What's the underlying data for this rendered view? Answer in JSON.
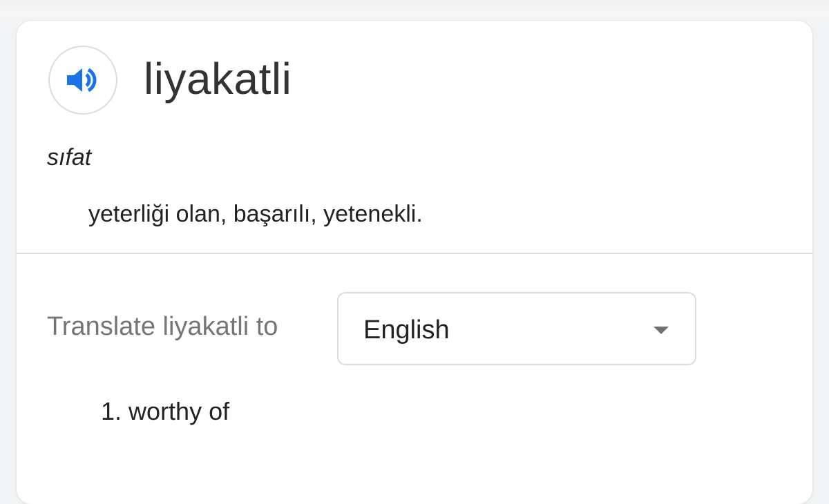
{
  "entry": {
    "word": "liyakatli",
    "part_of_speech": "sıfat",
    "definition": "yeterliği olan, başarılı, yetenekli."
  },
  "icons": {
    "speaker": "speaker-icon",
    "dropdown": "dropdown-arrow-icon"
  },
  "translate": {
    "label": "Translate liyakatli to",
    "selected_language": "English",
    "results": [
      {
        "number": "1.",
        "text": "worthy of"
      }
    ]
  },
  "colors": {
    "speaker_blue": "#1a73e8",
    "divider": "#dadce0",
    "muted_text": "#757575"
  }
}
